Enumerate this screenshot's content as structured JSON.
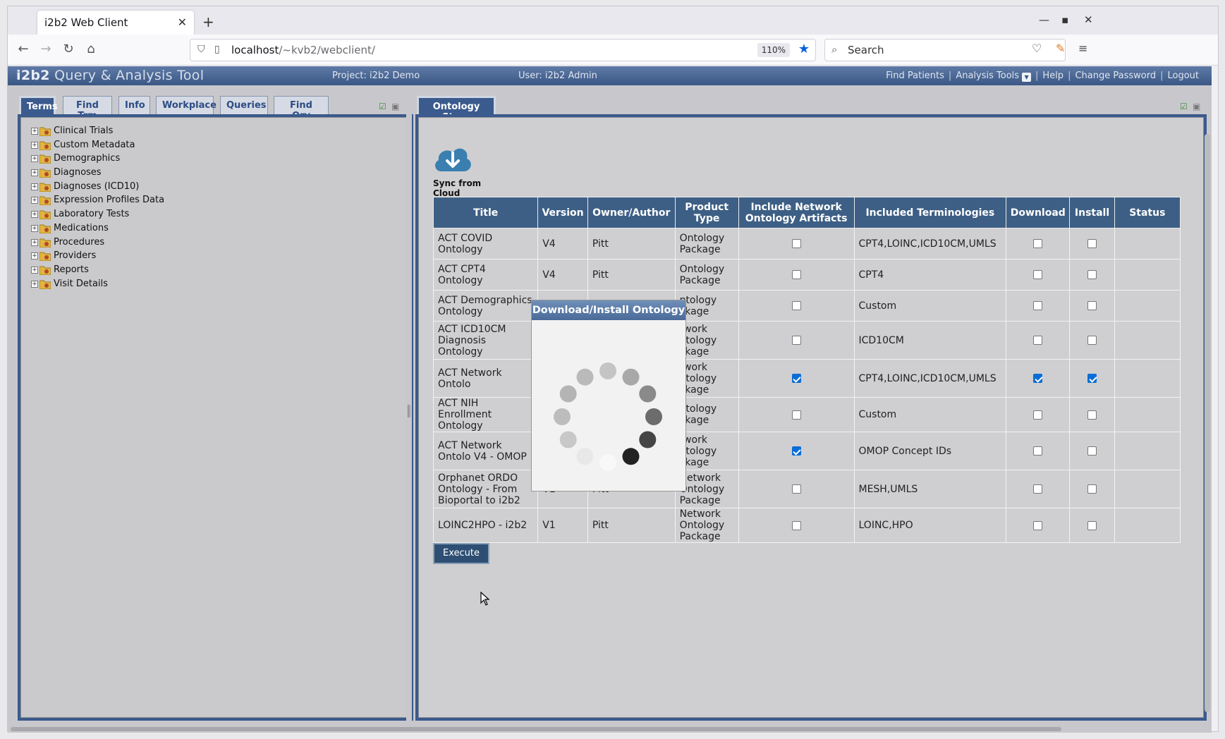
{
  "browser": {
    "tab_title": "i2b2 Web Client",
    "url_host": "localhost",
    "url_path": "/~kvb2/webclient/",
    "zoom": "110%",
    "search_placeholder": "Search"
  },
  "app": {
    "brand_prefix": "i2b2",
    "brand_title": "Query & Analysis Tool",
    "project": "Project: i2b2 Demo",
    "user": "User: i2b2 Admin",
    "links": {
      "find_patients": "Find Patients",
      "analysis_tools": "Analysis Tools",
      "help": "Help",
      "change_password": "Change Password",
      "logout": "Logout"
    }
  },
  "left_panel": {
    "tabs": [
      "Terms",
      "Find Trm",
      "Info",
      "Workplace",
      "Queries",
      "Find Qry"
    ],
    "active_tab": "Terms",
    "tree": [
      "Clinical Trials",
      "Custom Metadata",
      "Demographics",
      "Diagnoses",
      "Diagnoses (ICD10)",
      "Expression Profiles Data",
      "Laboratory Tests",
      "Medications",
      "Procedures",
      "Providers",
      "Reports",
      "Visit Details"
    ]
  },
  "right_panel": {
    "tab": "Ontology Store",
    "sync_label": "Sync from Cloud",
    "columns": [
      "Title",
      "Version",
      "Owner/Author",
      "Product Type",
      "Include Network Ontology Artifacts",
      "Included Terminologies",
      "Download",
      "Install",
      "Status"
    ],
    "rows": [
      {
        "title": "ACT COVID Ontology",
        "version": "V4",
        "owner": "Pitt",
        "type": "Ontology Package",
        "network": false,
        "terminologies": "CPT4,LOINC,ICD10CM,UMLS",
        "download": false,
        "install": false,
        "status": ""
      },
      {
        "title": "ACT CPT4 Ontology",
        "version": "V4",
        "owner": "Pitt",
        "type": "Ontology Package",
        "network": false,
        "terminologies": "CPT4",
        "download": false,
        "install": false,
        "status": ""
      },
      {
        "title": "ACT Demographics Ontology",
        "version": "",
        "owner": "",
        "type": "ntology ckage",
        "network": false,
        "terminologies": "Custom",
        "download": false,
        "install": false,
        "status": ""
      },
      {
        "title": "ACT ICD10CM Diagnosis Ontology",
        "version": "",
        "owner": "",
        "type": "twork ntology ckage",
        "network": false,
        "terminologies": "ICD10CM",
        "download": false,
        "install": false,
        "status": ""
      },
      {
        "title": "ACT Network Ontolo",
        "version": "",
        "owner": "",
        "type": "twork ntology ckage",
        "network": true,
        "terminologies": "CPT4,LOINC,ICD10CM,UMLS",
        "download": true,
        "install": true,
        "status": ""
      },
      {
        "title": "ACT NIH Enrollment Ontology",
        "version": "",
        "owner": "",
        "type": "ntology ckage",
        "network": false,
        "terminologies": "Custom",
        "download": false,
        "install": false,
        "status": ""
      },
      {
        "title": "ACT Network Ontolo V4 - OMOP",
        "version": "",
        "owner": "",
        "type": "twork ntology ckage",
        "network": true,
        "terminologies": "OMOP Concept IDs",
        "download": false,
        "install": false,
        "status": ""
      },
      {
        "title": "Orphanet ORDO Ontology - From Bioportal to i2b2",
        "version": "V1",
        "owner": "Pitt",
        "type": "Network Ontology Package",
        "network": false,
        "terminologies": "MESH,UMLS",
        "download": false,
        "install": false,
        "status": ""
      },
      {
        "title": "LOINC2HPO - i2b2",
        "version": "V1",
        "owner": "Pitt",
        "type": "Network Ontology Package",
        "network": false,
        "terminologies": "LOINC,HPO",
        "download": false,
        "install": false,
        "status": ""
      }
    ],
    "execute_label": "Execute"
  },
  "modal": {
    "title": "Download/Install Ontology"
  },
  "icons": {
    "back": "back-arrow-icon",
    "forward": "forward-arrow-icon",
    "reload": "reload-icon",
    "home": "home-icon",
    "folder": "folder-icon",
    "cloud": "cloud-download-icon"
  },
  "colors": {
    "header_blue": "#3b5a8d",
    "table_header": "#3d5f85",
    "checkbox_checked": "#0a6dd6"
  }
}
